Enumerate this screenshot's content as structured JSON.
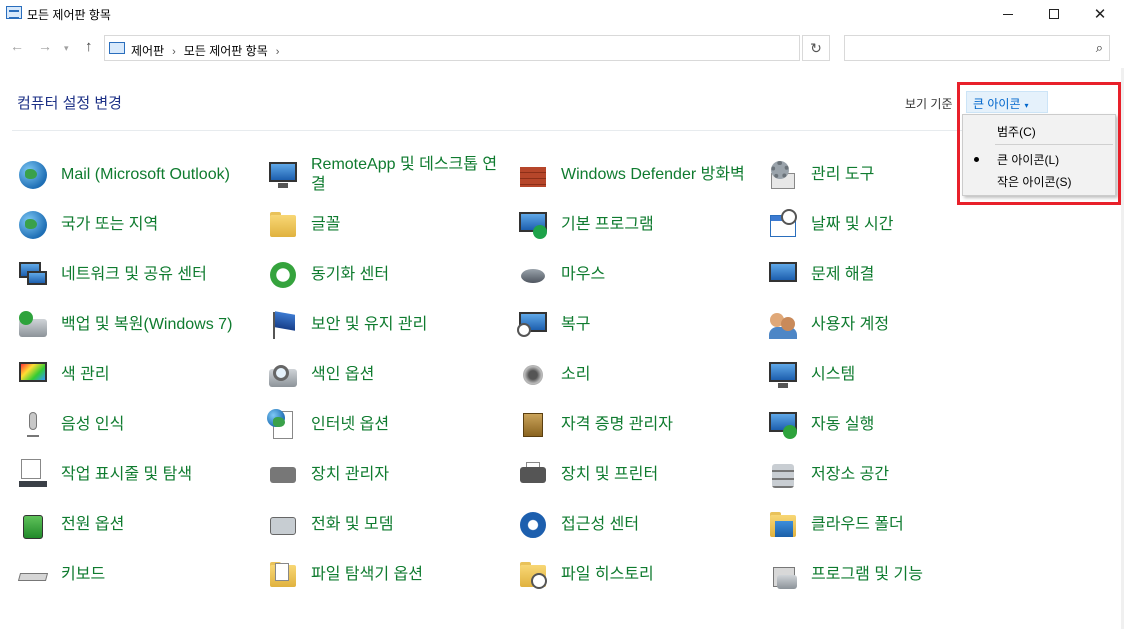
{
  "window": {
    "title": "모든 제어판 항목"
  },
  "nav": {
    "back_icon": "←",
    "forward_icon": "→",
    "recent_icon": "▾",
    "up_icon": "↑",
    "breadcrumb": [
      "제어판",
      "모든 제어판 항목"
    ],
    "breadcrumb_sep": "›",
    "dropdown_icon": "⌵",
    "refresh_icon": "↻",
    "search_placeholder": "",
    "search_icon": "⌕"
  },
  "header": {
    "title": "컴퓨터 설정 변경",
    "view_by_label": "보기 기준",
    "view_by_value": "큰 아이콘",
    "caret": "▾"
  },
  "view_menu": {
    "items": [
      {
        "label": "범주(C)",
        "selected": false
      },
      {
        "label": "큰 아이콘(L)",
        "selected": true
      },
      {
        "label": "작은 아이콘(S)",
        "selected": false
      }
    ]
  },
  "items": [
    {
      "label": "Mail (Microsoft Outlook)",
      "icon": "mail-icon"
    },
    {
      "label": "RemoteApp 및 데스크톱 연결",
      "icon": "remoteapp-icon"
    },
    {
      "label": "Windows Defender 방화벽",
      "icon": "firewall-icon"
    },
    {
      "label": "관리 도구",
      "icon": "admin-tools-icon"
    },
    {
      "label": "국가 또는 지역",
      "icon": "region-icon"
    },
    {
      "label": "글꼴",
      "icon": "fonts-icon"
    },
    {
      "label": "기본 프로그램",
      "icon": "default-programs-icon"
    },
    {
      "label": "날짜 및 시간",
      "icon": "date-time-icon"
    },
    {
      "label": "네트워크 및 공유 센터",
      "icon": "network-icon"
    },
    {
      "label": "동기화 센터",
      "icon": "sync-center-icon"
    },
    {
      "label": "마우스",
      "icon": "mouse-icon"
    },
    {
      "label": "문제 해결",
      "icon": "troubleshooting-icon"
    },
    {
      "label": "백업 및 복원(Windows 7)",
      "icon": "backup-icon"
    },
    {
      "label": "보안 및 유지 관리",
      "icon": "security-maintenance-icon"
    },
    {
      "label": "복구",
      "icon": "recovery-icon"
    },
    {
      "label": "사용자 계정",
      "icon": "user-accounts-icon"
    },
    {
      "label": "색 관리",
      "icon": "color-management-icon"
    },
    {
      "label": "색인 옵션",
      "icon": "indexing-icon"
    },
    {
      "label": "소리",
      "icon": "sound-icon"
    },
    {
      "label": "시스템",
      "icon": "system-icon"
    },
    {
      "label": "음성 인식",
      "icon": "speech-icon"
    },
    {
      "label": "인터넷 옵션",
      "icon": "internet-options-icon"
    },
    {
      "label": "자격 증명 관리자",
      "icon": "credential-manager-icon"
    },
    {
      "label": "자동 실행",
      "icon": "autoplay-icon"
    },
    {
      "label": "작업 표시줄 및 탐색",
      "icon": "taskbar-icon"
    },
    {
      "label": "장치 관리자",
      "icon": "device-manager-icon"
    },
    {
      "label": "장치 및 프린터",
      "icon": "printers-icon"
    },
    {
      "label": "저장소 공간",
      "icon": "storage-spaces-icon"
    },
    {
      "label": "전원 옵션",
      "icon": "power-icon"
    },
    {
      "label": "전화 및 모뎀",
      "icon": "phone-modem-icon"
    },
    {
      "label": "접근성 센터",
      "icon": "ease-of-access-icon"
    },
    {
      "label": "클라우드 폴더",
      "icon": "work-folders-icon"
    },
    {
      "label": "키보드",
      "icon": "keyboard-icon"
    },
    {
      "label": "파일 탐색기 옵션",
      "icon": "file-explorer-options-icon"
    },
    {
      "label": "파일 히스토리",
      "icon": "file-history-icon"
    },
    {
      "label": "프로그램 및 기능",
      "icon": "programs-features-icon"
    }
  ]
}
